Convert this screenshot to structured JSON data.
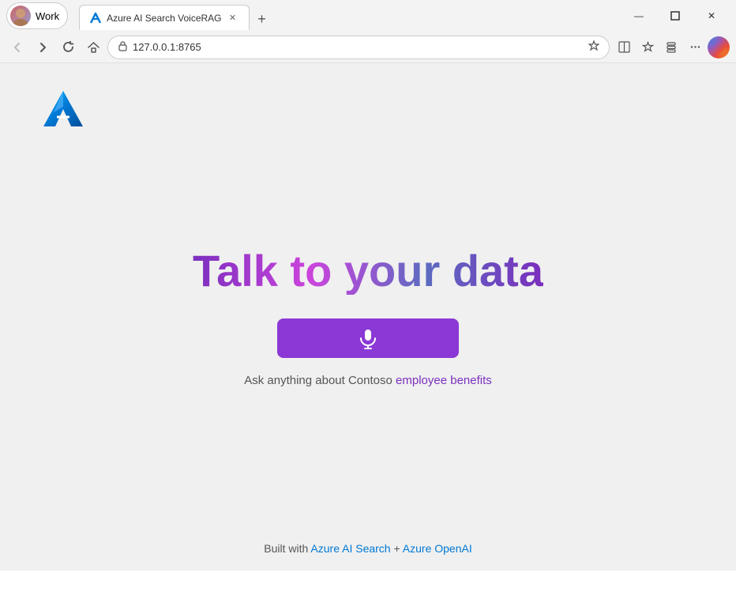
{
  "browser": {
    "profile_label": "Work",
    "tab": {
      "title": "Azure AI Search VoiceRAG",
      "favicon": "A",
      "url": "127.0.0.1:8765"
    },
    "window_controls": {
      "minimize": "—",
      "maximize": "❐",
      "close": "✕"
    }
  },
  "page": {
    "logo_alt": "Azure AI Logo",
    "hero_title": "Talk to your data",
    "mic_button_label": "🎤",
    "subtitle_plain": "Ask anything about Contoso ",
    "subtitle_highlight": "employee benefits",
    "footer_text": "Built with ",
    "footer_link1": "Azure AI Search",
    "footer_connector": " + ",
    "footer_link2": "Azure OpenAI"
  },
  "icons": {
    "back": "←",
    "forward": "→",
    "refresh": "↻",
    "home": "⌂",
    "secure": "🔒",
    "star": "☆",
    "split_screen": "⧉",
    "favorites": "★",
    "collections": "📎",
    "more": "…",
    "mic": "🎤"
  }
}
